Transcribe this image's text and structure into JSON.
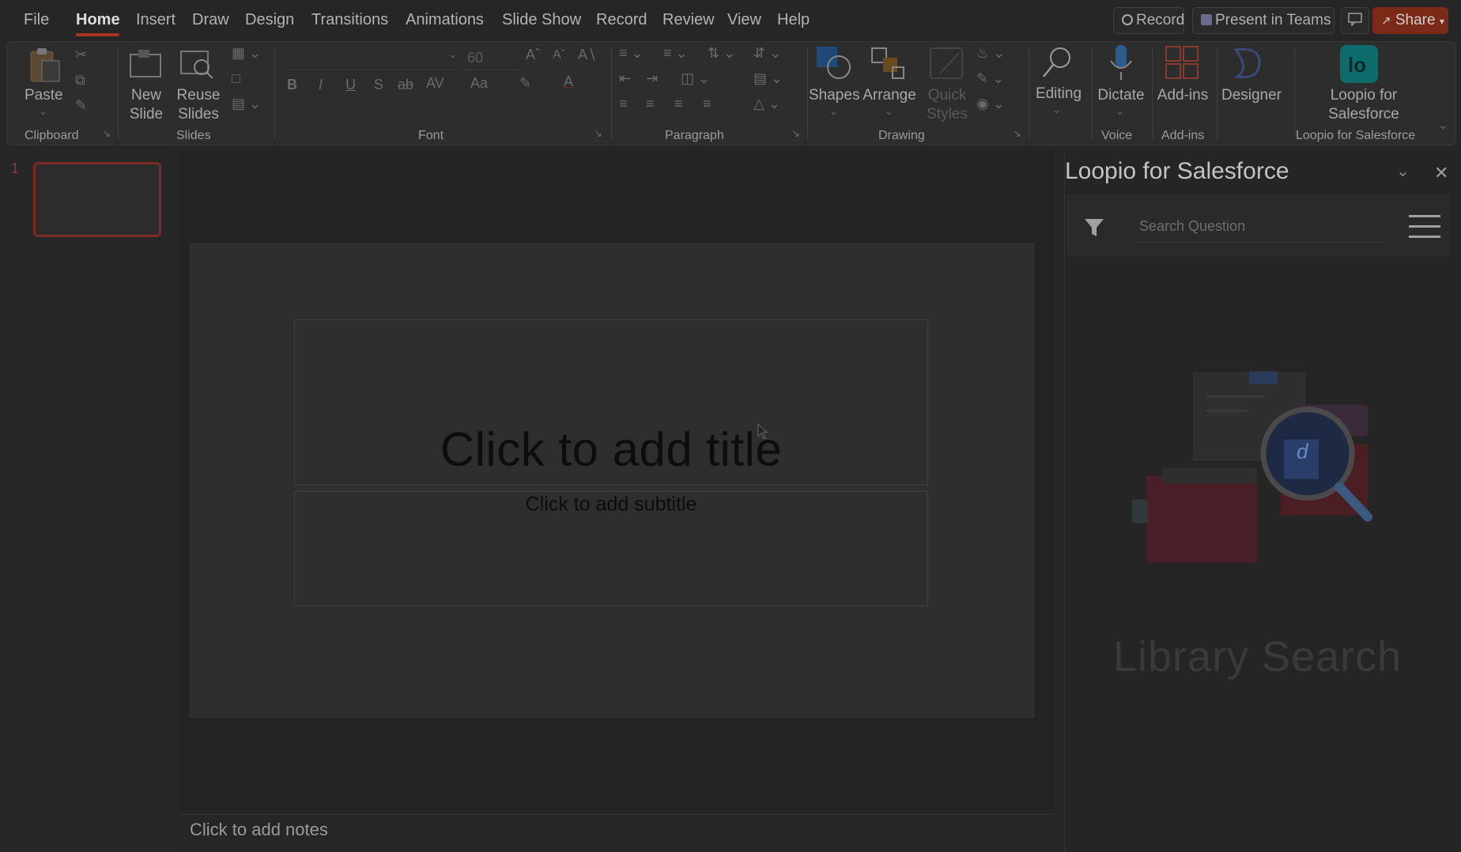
{
  "menu": {
    "tabs": [
      "File",
      "Home",
      "Insert",
      "Draw",
      "Design",
      "Transitions",
      "Animations",
      "Slide Show",
      "Record",
      "Review",
      "View",
      "Help"
    ],
    "active_tab": "Home"
  },
  "top_buttons": {
    "record": "Record",
    "present": "Present in Teams",
    "share": "Share"
  },
  "ribbon": {
    "groups": {
      "clipboard": "Clipboard",
      "slides": "Slides",
      "font": "Font",
      "paragraph": "Paragraph",
      "drawing": "Drawing",
      "voice": "Voice",
      "addins": "Add-ins",
      "loopio": "Loopio for Salesforce"
    },
    "paste": "Paste",
    "new_slide": [
      "New",
      "Slide"
    ],
    "reuse_slides": [
      "Reuse",
      "Slides"
    ],
    "font_size": "60",
    "shapes": "Shapes",
    "arrange": "Arrange",
    "quick_styles": [
      "Quick",
      "Styles"
    ],
    "editing": "Editing",
    "dictate": "Dictate",
    "addins_btn": "Add-ins",
    "designer": "Designer",
    "loopio_btn": [
      "Loopio for",
      "Salesforce"
    ],
    "font_buttons": {
      "bold": "B",
      "italic": "I",
      "underline": "U",
      "shadow": "S",
      "strike": "ab",
      "spacing": "AV",
      "case": "Aa",
      "color": "A"
    }
  },
  "thumbnails": {
    "slide_number": "1"
  },
  "slide": {
    "title_placeholder": "Click to add title",
    "subtitle_placeholder": "Click to add subtitle"
  },
  "notes": {
    "placeholder": "Click to add notes"
  },
  "panel": {
    "title": "Loopio for Salesforce",
    "search_placeholder": "Search Question",
    "library_text": "Library Search"
  },
  "colors": {
    "accent": "#a8351f",
    "loopio_brand": "#0e6b6b",
    "background_dim": "#262626"
  }
}
